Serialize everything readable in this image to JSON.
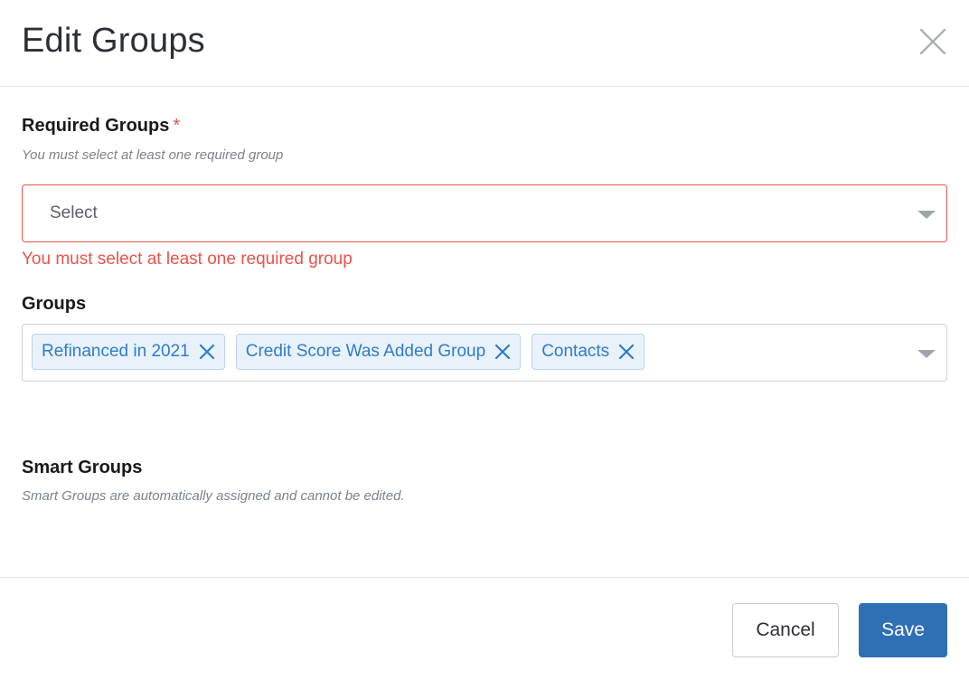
{
  "dialog": {
    "title": "Edit Groups"
  },
  "required_groups": {
    "label": "Required Groups",
    "required_marker": "*",
    "helper": "You must select at least one required group",
    "placeholder": "Select",
    "error": "You must select at least one required group"
  },
  "groups": {
    "label": "Groups",
    "chips": [
      {
        "label": "Refinanced in 2021"
      },
      {
        "label": "Credit Score Was Added Group"
      },
      {
        "label": "Contacts"
      }
    ]
  },
  "smart_groups": {
    "label": "Smart Groups",
    "helper": "Smart Groups are automatically assigned and cannot be edited."
  },
  "footer": {
    "cancel_label": "Cancel",
    "save_label": "Save"
  },
  "colors": {
    "error": "#e8534a",
    "accent": "#2f6fb5",
    "chip_bg": "#e9f2fb",
    "chip_text": "#2f7cc9"
  },
  "icons": {
    "close": "close-icon",
    "caret": "chevron-down-icon",
    "chip_remove": "close-icon"
  }
}
